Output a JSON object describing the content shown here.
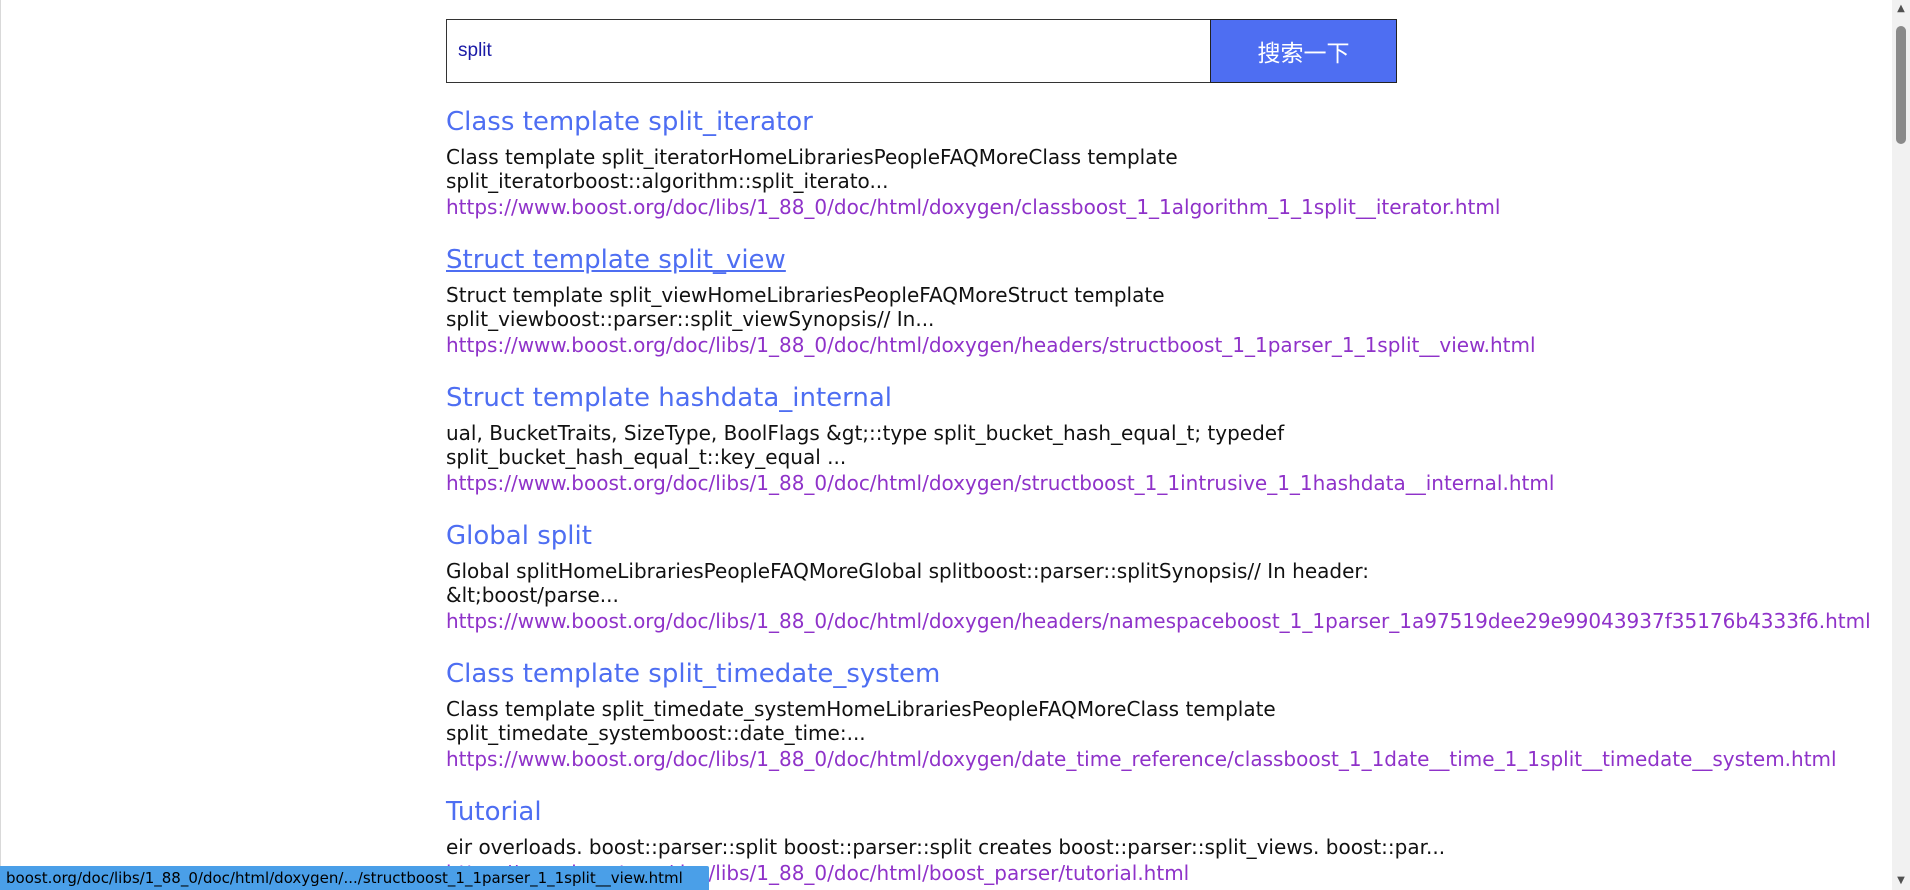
{
  "search": {
    "query": "split",
    "button_label": "搜索一下"
  },
  "results": [
    {
      "title": "Class template split_iterator",
      "snippet": "Class template split_iteratorHomeLibrariesPeopleFAQMoreClass template split_iteratorboost::algorithm::split_iterato...",
      "url": "https://www.boost.org/doc/libs/1_88_0/doc/html/doxygen/classboost_1_1algorithm_1_1split__iterator.html"
    },
    {
      "title": "Struct template split_view",
      "snippet": "Struct template split_viewHomeLibrariesPeopleFAQMoreStruct template split_viewboost::parser::split_viewSynopsis// In...",
      "url": "https://www.boost.org/doc/libs/1_88_0/doc/html/doxygen/headers/structboost_1_1parser_1_1split__view.html"
    },
    {
      "title": "Struct template hashdata_internal",
      "snippet": "ual, BucketTraits, SizeType, BoolFlags &gt;::type split_bucket_hash_equal_t; typedef split_bucket_hash_equal_t::key_equal ...",
      "url": "https://www.boost.org/doc/libs/1_88_0/doc/html/doxygen/structboost_1_1intrusive_1_1hashdata__internal.html"
    },
    {
      "title": "Global split",
      "snippet": "Global splitHomeLibrariesPeopleFAQMoreGlobal splitboost::parser::splitSynopsis// In header: &lt;boost/parse...",
      "url": "https://www.boost.org/doc/libs/1_88_0/doc/html/doxygen/headers/namespaceboost_1_1parser_1a97519dee29e99043937f35176b4333f6.html"
    },
    {
      "title": "Class template split_timedate_system",
      "snippet": "Class template split_timedate_systemHomeLibrariesPeopleFAQMoreClass template split_timedate_systemboost::date_time:...",
      "url": "https://www.boost.org/doc/libs/1_88_0/doc/html/doxygen/date_time_reference/classboost_1_1date__time_1_1split__timedate__system.html"
    },
    {
      "title": "Tutorial",
      "snippet": "eir overloads. boost::parser::split boost::parser::split creates boost::parser::split_views. boost::par...",
      "url": "https://www.boost.org/doc/libs/1_88_0/doc/html/boost_parser/tutorial.html"
    }
  ],
  "status_bar": {
    "url": "boost.org/doc/libs/1_88_0/doc/html/doxygen/.../structboost_1_1parser_1_1split__view.html"
  },
  "scrollbar": {
    "up_icon": "▲",
    "down_icon": "▼"
  },
  "colors": {
    "accent": "#4e6ef2",
    "visited_link": "#8f32c9",
    "status_bar": "#4a9fe8"
  }
}
